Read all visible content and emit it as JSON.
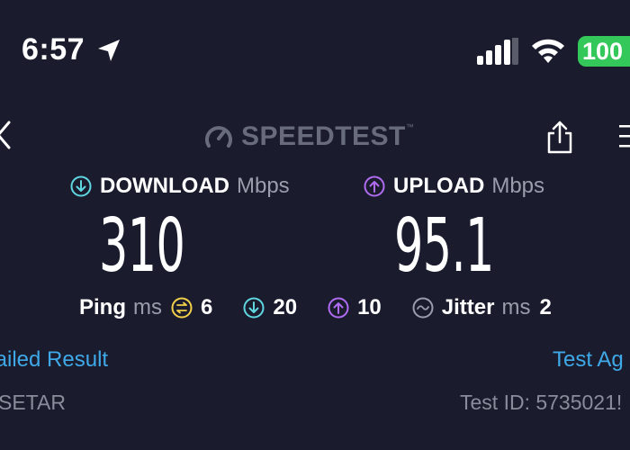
{
  "status_bar": {
    "time": "6:57",
    "location_icon": "location-arrow-icon",
    "signal_icon": "cellular-signal-icon",
    "wifi_icon": "wifi-icon",
    "battery": "100",
    "battery_color": "#34c759"
  },
  "header": {
    "back_icon": "chevron-left-icon",
    "logo_text": "SPEEDTEST",
    "logo_mark": "™",
    "share_icon": "share-icon",
    "menu_icon": "menu-icon"
  },
  "download": {
    "label": "DOWNLOAD",
    "unit": "Mbps",
    "value": "310",
    "icon": "download-arrow-icon",
    "color": "#5fd6e0"
  },
  "upload": {
    "label": "UPLOAD",
    "unit": "Mbps",
    "value": "95.1",
    "icon": "upload-arrow-icon",
    "color": "#b06cf0"
  },
  "ping": {
    "label": "Ping",
    "unit": "ms",
    "idle_value": "6",
    "download_value": "20",
    "upload_value": "10",
    "idle_color": "#f2d04a"
  },
  "jitter": {
    "label": "Jitter",
    "unit": "ms",
    "value": "2"
  },
  "footer": {
    "detailed_result": "tailed Result",
    "test_again": "Test Ag",
    "isp": "SETAR",
    "test_id": "Test ID: 5735021!"
  },
  "colors": {
    "background": "#1a1c2e",
    "link": "#3fa9e8",
    "muted": "#9b9dac"
  }
}
